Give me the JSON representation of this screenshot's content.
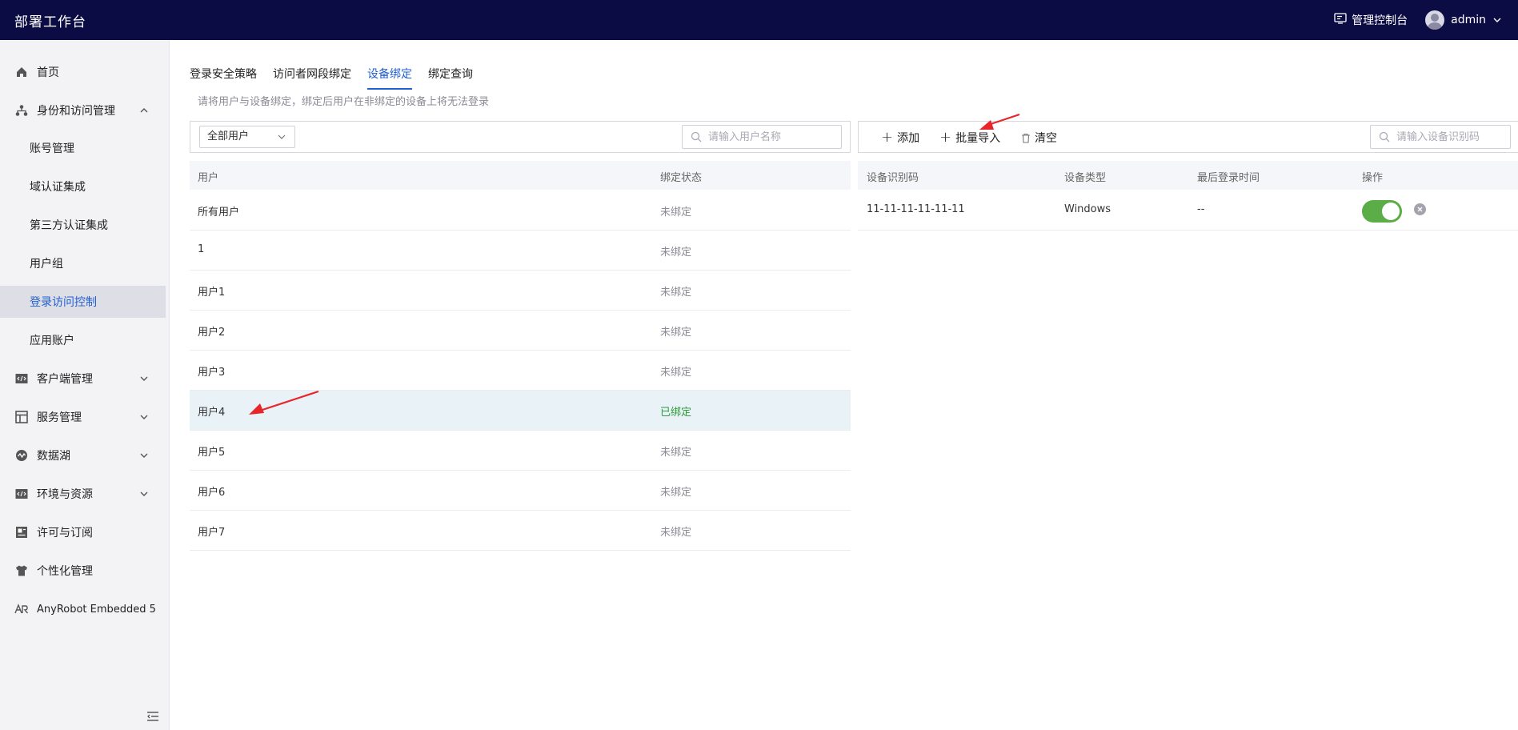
{
  "header": {
    "app_title": "部署工作台",
    "console_label": "管理控制台",
    "username": "admin"
  },
  "sidebar": {
    "items": [
      {
        "label": "首页",
        "icon": "home-icon"
      },
      {
        "label": "身份和访问管理",
        "icon": "org-icon",
        "expanded": true
      },
      {
        "label": "账号管理"
      },
      {
        "label": "域认证集成"
      },
      {
        "label": "第三方认证集成"
      },
      {
        "label": "用户组"
      },
      {
        "label": "登录访问控制",
        "active": true
      },
      {
        "label": "应用账户"
      },
      {
        "label": "客户端管理",
        "icon": "code-icon"
      },
      {
        "label": "服务管理",
        "icon": "layout-icon"
      },
      {
        "label": "数据湖",
        "icon": "wave-icon"
      },
      {
        "label": "环境与资源",
        "icon": "code-icon"
      },
      {
        "label": "许可与订阅",
        "icon": "license-icon"
      },
      {
        "label": "个性化管理",
        "icon": "shirt-icon"
      },
      {
        "label": "AnyRobot Embedded 5",
        "icon": "anyrobot-logo-icon"
      }
    ]
  },
  "tabs": [
    "登录安全策略",
    "访问者网段绑定",
    "设备绑定",
    "绑定查询"
  ],
  "active_tab": "设备绑定",
  "hint": "请将用户与设备绑定，绑定后用户在非绑定的设备上将无法登录",
  "left_panel": {
    "filter_value": "全部用户",
    "search_placeholder": "请输入用户名称",
    "columns": [
      "用户",
      "绑定状态"
    ],
    "rows": [
      {
        "user": "所有用户",
        "status": "未绑定"
      },
      {
        "user": "1",
        "status": "未绑定"
      },
      {
        "user": "用户1",
        "status": "未绑定"
      },
      {
        "user": "用户2",
        "status": "未绑定"
      },
      {
        "user": "用户3",
        "status": "未绑定"
      },
      {
        "user": "用户4",
        "status": "已绑定",
        "selected": true
      },
      {
        "user": "用户5",
        "status": "未绑定"
      },
      {
        "user": "用户6",
        "status": "未绑定"
      },
      {
        "user": "用户7",
        "status": "未绑定"
      }
    ]
  },
  "right_panel": {
    "add_label": "添加",
    "import_label": "批量导入",
    "clear_label": "清空",
    "search_placeholder": "请输入设备识别码",
    "columns": [
      "设备识别码",
      "设备类型",
      "最后登录时间",
      "操作"
    ],
    "rows": [
      {
        "device_id": "11-11-11-11-11-11",
        "type": "Windows",
        "last_login": "--",
        "enabled": true
      }
    ]
  },
  "colors": {
    "header_bg": "#0c0c45",
    "accent": "#1f5fd1",
    "bound_green": "#2f9a3a",
    "toggle_green": "#5aad47",
    "annotation_red": "#e8262a"
  }
}
